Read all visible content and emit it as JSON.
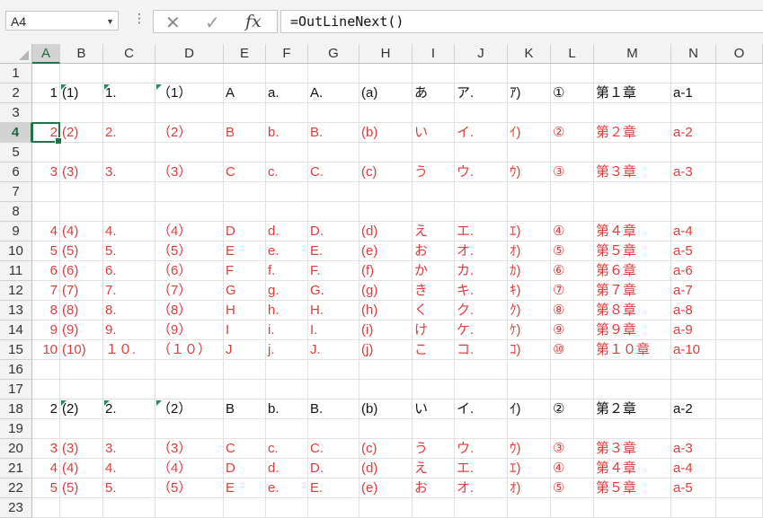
{
  "namebox": {
    "value": "A4"
  },
  "formula_bar": {
    "dots": "⋮",
    "cancel": "✕",
    "enter": "✓",
    "fx": "fx",
    "value": "=OutLineNext()"
  },
  "sheet": {
    "selected": "A4",
    "columns": [
      "A",
      "B",
      "C",
      "D",
      "E",
      "F",
      "G",
      "H",
      "I",
      "J",
      "K",
      "L",
      "M",
      "N",
      "O"
    ],
    "rows": [
      {
        "n": "1",
        "cells": []
      },
      {
        "n": "2",
        "color": "black",
        "ind": true,
        "cells": [
          "1",
          "(1)",
          "1.",
          "（1）",
          "A",
          "a.",
          "A.",
          "(a)",
          "あ",
          "ア.",
          "ｱ)",
          "①",
          "第１章",
          "a-1"
        ]
      },
      {
        "n": "3",
        "cells": []
      },
      {
        "n": "4",
        "color": "red",
        "cells": [
          "2",
          "(2)",
          "2.",
          "（2）",
          "B",
          "b.",
          "B.",
          "(b)",
          "い",
          "イ.",
          "ｲ)",
          "②",
          "第２章",
          "a-2"
        ]
      },
      {
        "n": "5",
        "cells": []
      },
      {
        "n": "6",
        "color": "red",
        "cells": [
          "3",
          "(3)",
          "3.",
          "（3）",
          "C",
          "c.",
          "C.",
          "(c)",
          "う",
          "ウ.",
          "ｳ)",
          "③",
          "第３章",
          "a-3"
        ]
      },
      {
        "n": "7",
        "cells": []
      },
      {
        "n": "8",
        "cells": []
      },
      {
        "n": "9",
        "color": "red",
        "cells": [
          "4",
          "(4)",
          "4.",
          "（4）",
          "D",
          "d.",
          "D.",
          "(d)",
          "え",
          "エ.",
          "ｴ)",
          "④",
          "第４章",
          "a-4"
        ]
      },
      {
        "n": "10",
        "color": "red",
        "cells": [
          "5",
          "(5)",
          "5.",
          "（5）",
          "E",
          "e.",
          "E.",
          "(e)",
          "お",
          "オ.",
          "ｵ)",
          "⑤",
          "第５章",
          "a-5"
        ]
      },
      {
        "n": "11",
        "color": "red",
        "cells": [
          "6",
          "(6)",
          "6.",
          "（6）",
          "F",
          "f.",
          "F.",
          "(f)",
          "か",
          "カ.",
          "ｶ)",
          "⑥",
          "第６章",
          "a-6"
        ]
      },
      {
        "n": "12",
        "color": "red",
        "cells": [
          "7",
          "(7)",
          "7.",
          "（7）",
          "G",
          "g.",
          "G.",
          "(g)",
          "き",
          "キ.",
          "ｷ)",
          "⑦",
          "第７章",
          "a-7"
        ]
      },
      {
        "n": "13",
        "color": "red",
        "cells": [
          "8",
          "(8)",
          "8.",
          "（8）",
          "H",
          "h.",
          "H.",
          "(h)",
          "く",
          "ク.",
          "ｸ)",
          "⑧",
          "第８章",
          "a-8"
        ]
      },
      {
        "n": "14",
        "color": "red",
        "cells": [
          "9",
          "(9)",
          "9.",
          "（9）",
          "I",
          "i.",
          "I.",
          "(i)",
          "け",
          "ケ.",
          "ｹ)",
          "⑨",
          "第９章",
          "a-9"
        ]
      },
      {
        "n": "15",
        "color": "red",
        "cells": [
          "10",
          "(10)",
          "１０.",
          "（１０）",
          "J",
          "j.",
          "J.",
          "(j)",
          "こ",
          "コ.",
          "ｺ)",
          "⑩",
          "第１０章",
          "a-10"
        ]
      },
      {
        "n": "16",
        "cells": []
      },
      {
        "n": "17",
        "cells": []
      },
      {
        "n": "18",
        "color": "black",
        "ind": true,
        "cells": [
          "2",
          "(2)",
          "2.",
          "（2）",
          "B",
          "b.",
          "B.",
          "(b)",
          "い",
          "イ.",
          "ｲ)",
          "②",
          "第２章",
          "a-2"
        ]
      },
      {
        "n": "19",
        "cells": []
      },
      {
        "n": "20",
        "color": "red",
        "cells": [
          "3",
          "(3)",
          "3.",
          "（3）",
          "C",
          "c.",
          "C.",
          "(c)",
          "う",
          "ウ.",
          "ｳ)",
          "③",
          "第３章",
          "a-3"
        ]
      },
      {
        "n": "21",
        "color": "red",
        "cells": [
          "4",
          "(4)",
          "4.",
          "（4）",
          "D",
          "d.",
          "D.",
          "(d)",
          "え",
          "エ.",
          "ｴ)",
          "④",
          "第４章",
          "a-4"
        ]
      },
      {
        "n": "22",
        "color": "red",
        "cells": [
          "5",
          "(5)",
          "5.",
          "（5）",
          "E",
          "e.",
          "E.",
          "(e)",
          "お",
          "オ.",
          "ｵ)",
          "⑤",
          "第５章",
          "a-5"
        ]
      },
      {
        "n": "23",
        "cells": []
      }
    ]
  },
  "colors": {
    "red_text": "#e03c3c",
    "selection": "#217346",
    "indicator": "#2e8b57"
  }
}
